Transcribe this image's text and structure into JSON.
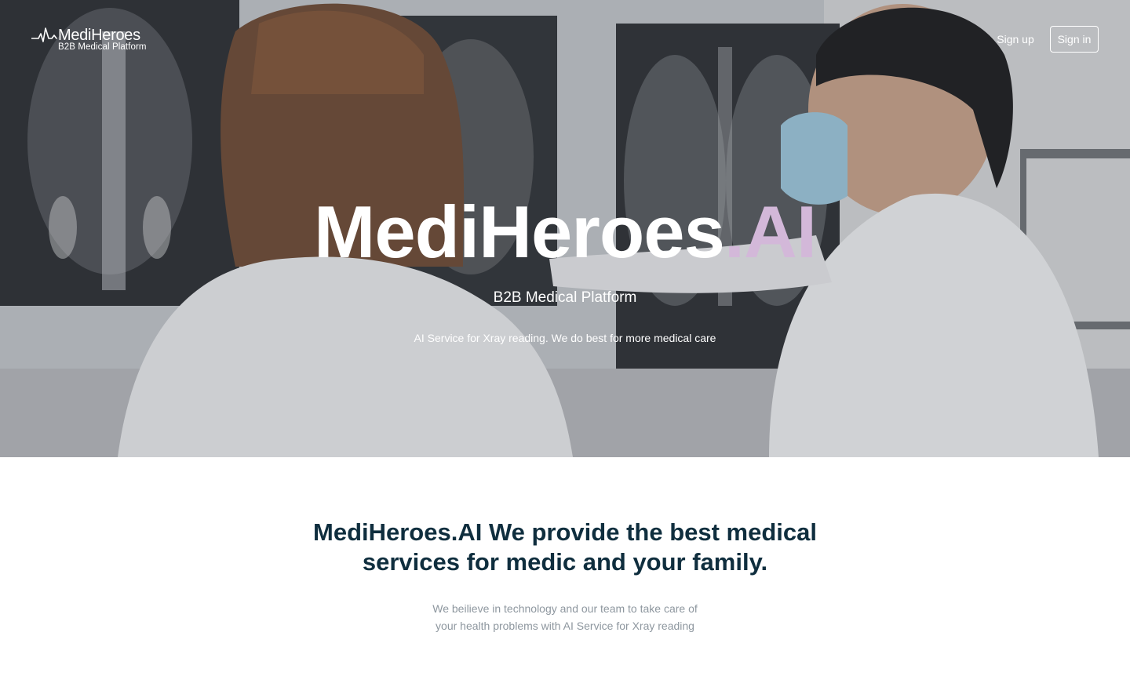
{
  "header": {
    "logo_name": "MediHeroes",
    "logo_subtitle": "B2B Medical Platform",
    "signup_label": "Sign up",
    "signin_label": "Sign in"
  },
  "hero": {
    "title_main": "MediHeroes",
    "title_accent": ".AI",
    "subtitle": "B2B Medical Platform",
    "tagline": "AI Service for Xray reading. We do best for more medical care"
  },
  "about": {
    "headline": "MediHeroes.AI We provide the best medical services for medic and your family.",
    "description_line1": "We beilieve in technology and our team to take care of",
    "description_line2": "your health problems with AI Service for Xray reading"
  },
  "colors": {
    "accent": "#d3b8d9",
    "heading": "#0f2e3e",
    "muted_text": "#8e979f"
  },
  "icons": {
    "logo": "heartbeat-icon"
  }
}
